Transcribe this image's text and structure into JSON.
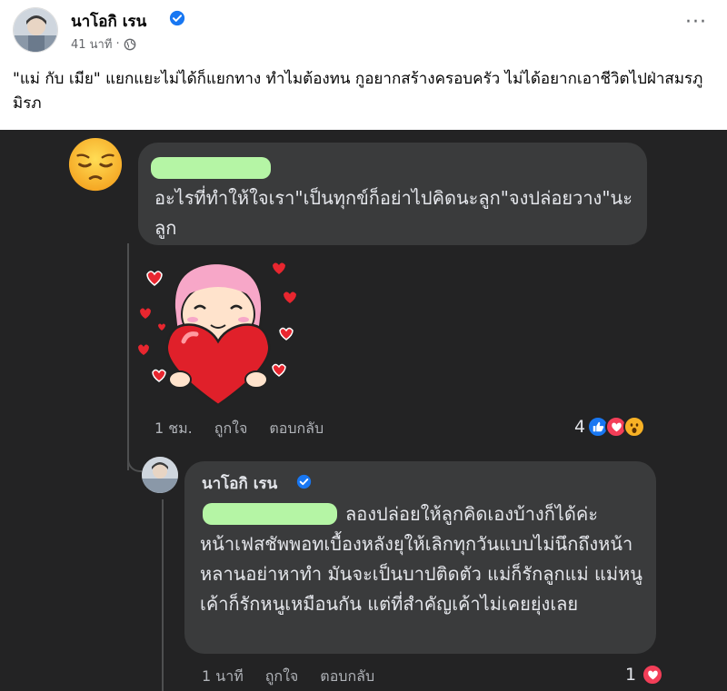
{
  "post": {
    "author": "นาโอกิ เรน",
    "time": "41 นาที",
    "separator": "·",
    "more_label": "···",
    "caption": "\"แม่ กับ เมีย\" แยกแยะไม่ได้ก็แยกทาง ทำไมต้องทน กูอยากสร้างครอบครัว ไม่ได้อยากเอาชีวิตไปฝ่าสมรภูมิรภ"
  },
  "comment1": {
    "text": "อะไรที่ทำให้ใจเรา\"เป็นทุกข์ก็อย่าไปคิดนะลูก\"จงปล่อยวาง\"นะลูก",
    "time": "1 ชม.",
    "like_label": "ถูกใจ",
    "reply_label": "ตอบกลับ",
    "reaction_count": "4",
    "reactions": [
      "like-icon",
      "love-icon",
      "wow-icon"
    ]
  },
  "comment2": {
    "author": "นาโอกิ เรน",
    "line1": "ลองปล่อยให้ลูกคิดเองบ้างก็ได้ค่ะ",
    "rest": "หน้าเฟสชัพพอทเบื้องหลังยุให้เลิกทุกวันแบบไม่นึกถึงหน้าหลานอย่าหาทำ มันจะเป็นบาปติดตัว แม่ก็รักลูกแม่ แม่หนูเค้าก็รักหนูเหมือนกัน แต่ที่สำคัญเค้าไม่เคยยุ่งเลย",
    "time": "1 นาที",
    "like_label": "ถูกใจ",
    "reply_label": "ตอบกลับ",
    "reaction_count": "1",
    "reactions": [
      "love-icon"
    ]
  },
  "colors": {
    "dark_bg": "#232324",
    "bubble": "#3a3b3c",
    "redaction": "#b5f5a5",
    "verified": "#1877f2",
    "love": "#f33e58",
    "like": "#1877f2"
  }
}
